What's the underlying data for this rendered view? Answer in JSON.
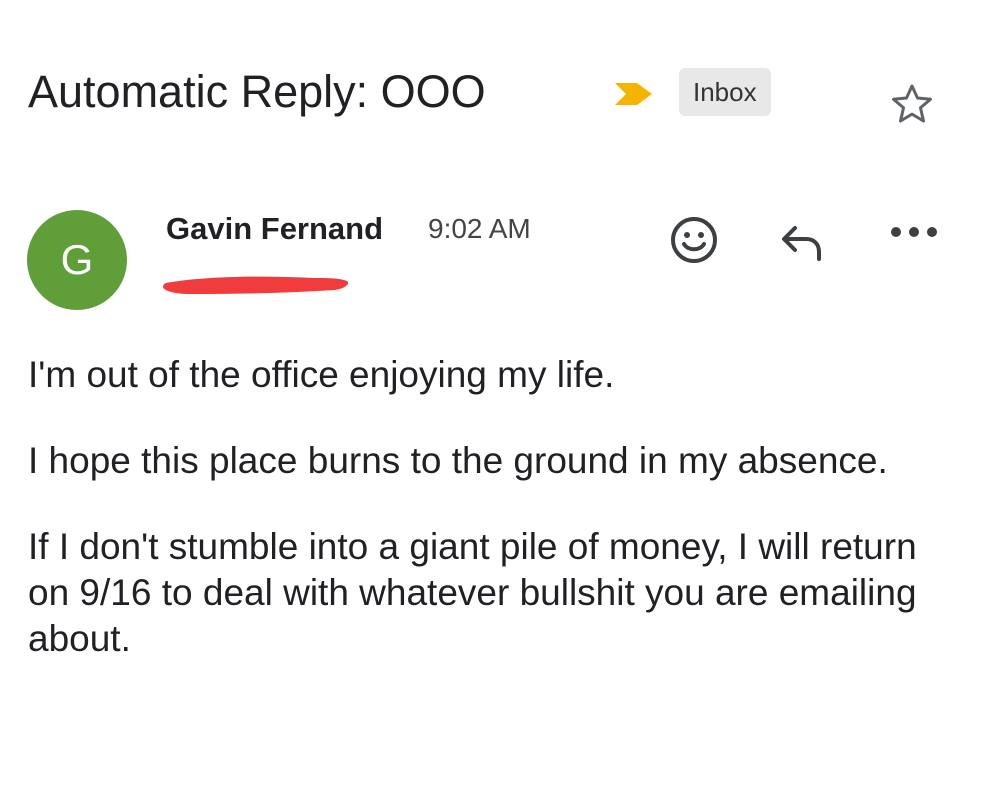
{
  "email": {
    "subject": "Automatic Reply: OOO",
    "label": "Inbox",
    "sender_initial": "G",
    "sender_name": "Gavin Fernand",
    "time": "9:02 AM",
    "body": [
      "I'm out of the office enjoying my life.",
      "I hope this place burns to the ground in my absence.",
      "If I don't stumble into a giant pile of money, I will return on 9/16 to deal with whatever bullshit you are emailing about."
    ]
  },
  "icons": {
    "importance": "importance-marker-icon",
    "star": "star-icon",
    "emoji": "emoji-reaction-icon",
    "reply": "reply-icon",
    "more": "more-options-icon"
  },
  "colors": {
    "avatar": "#5f9e39",
    "importance_marker": "#f4b400",
    "redaction": "#f03c3c",
    "chip_background": "#e8e8e8"
  }
}
